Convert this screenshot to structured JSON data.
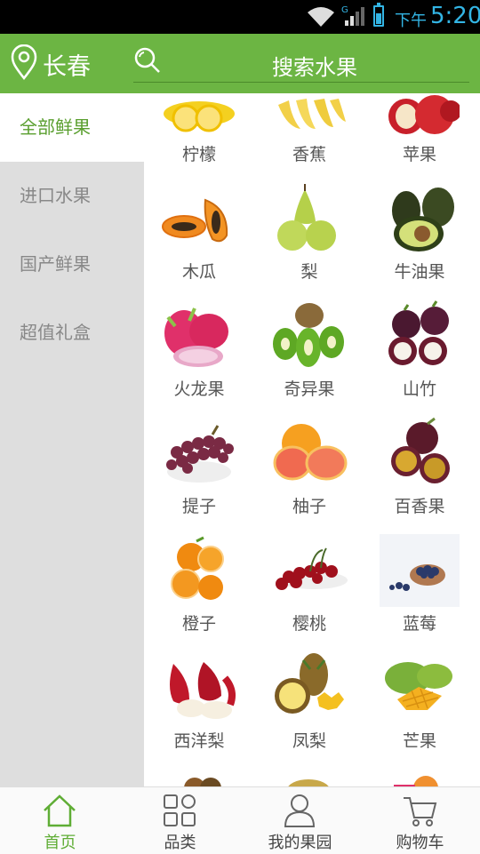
{
  "status_bar": {
    "ampm": "下午",
    "time": "5:20",
    "network": "G"
  },
  "header": {
    "city": "长春",
    "search_placeholder": "搜索水果"
  },
  "sidebar": {
    "items": [
      {
        "label": "全部鲜果",
        "active": true
      },
      {
        "label": "进口水果",
        "active": false
      },
      {
        "label": "国产鲜果",
        "active": false
      },
      {
        "label": "超值礼盒",
        "active": false
      }
    ]
  },
  "products": [
    {
      "name": "柠檬"
    },
    {
      "name": "香蕉"
    },
    {
      "name": "苹果"
    },
    {
      "name": "木瓜"
    },
    {
      "name": "梨"
    },
    {
      "name": "牛油果"
    },
    {
      "name": "火龙果"
    },
    {
      "name": "奇异果"
    },
    {
      "name": "山竹"
    },
    {
      "name": "提子"
    },
    {
      "name": "柚子"
    },
    {
      "name": "百香果"
    },
    {
      "name": "橙子"
    },
    {
      "name": "樱桃"
    },
    {
      "name": "蓝莓"
    },
    {
      "name": "西洋梨"
    },
    {
      "name": "凤梨"
    },
    {
      "name": "芒果"
    }
  ],
  "tabbar": {
    "items": [
      {
        "label": "首页",
        "icon": "home-icon",
        "active": true
      },
      {
        "label": "品类",
        "icon": "category-icon",
        "active": false
      },
      {
        "label": "我的果园",
        "icon": "user-icon",
        "active": false
      },
      {
        "label": "购物车",
        "icon": "cart-icon",
        "active": false
      }
    ]
  },
  "colors": {
    "brand_green": "#6cb543",
    "active_text": "#5a9f2f",
    "status_blue": "#33b5e5"
  }
}
